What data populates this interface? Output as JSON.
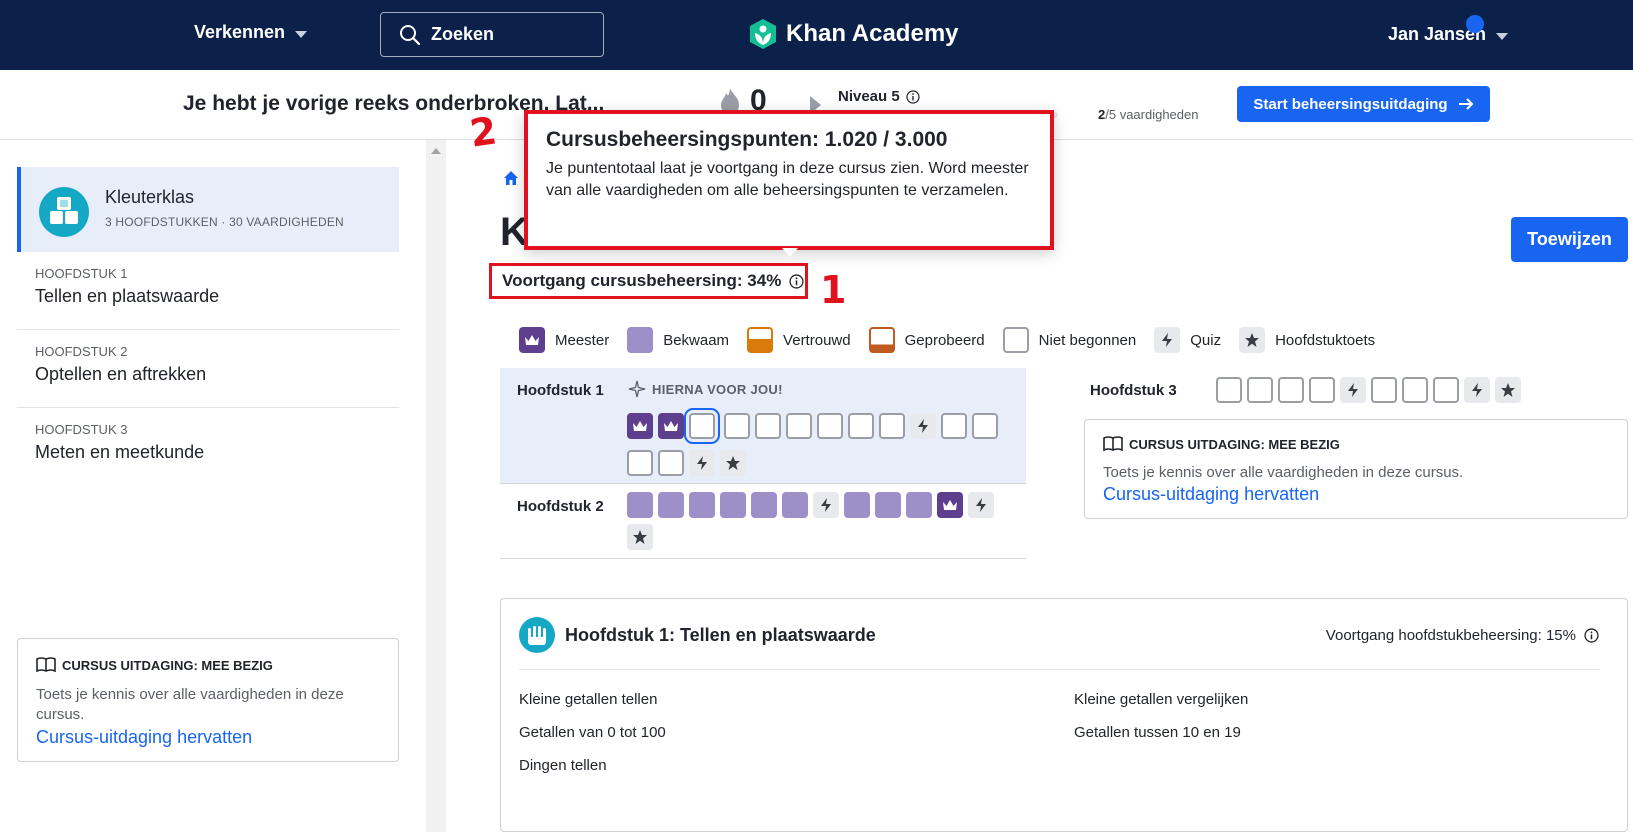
{
  "nav": {
    "explore": "Verkennen",
    "search_label": "Zoeken",
    "logo": "Khan Academy",
    "user": "Jan Jansen"
  },
  "streak": {
    "message": "Je hebt je vorige reeks onderbroken. Lat...",
    "count": "0",
    "level": "Niveau 5",
    "skills_done": "2",
    "skills_total": "/5 vaardigheden",
    "level_fraction": 0.4,
    "start_button": "Start beheersingsuitdaging"
  },
  "sidebar": {
    "course_title": "Kleuterklas",
    "course_meta": "3 HOOFDSTUKKEN · 30 VAARDIGHEDEN",
    "units": [
      {
        "label": "HOOFDSTUK 1",
        "title": "Tellen en plaatswaarde"
      },
      {
        "label": "HOOFDSTUK 2",
        "title": "Optellen en aftrekken"
      },
      {
        "label": "HOOFDSTUK 3",
        "title": "Meten en meetkunde"
      }
    ],
    "challenge_title": "CURSUS UITDAGING: MEE BEZIG",
    "challenge_desc": "Toets je kennis over alle vaardigheden in deze cursus.",
    "challenge_link": "Cursus-uitdaging hervatten"
  },
  "main": {
    "title_partial": "K",
    "assign_button": "Toewijzen",
    "mastery_progress": "Voortgang cursusbeheersing: 34%",
    "annotation_1": "1",
    "annotation_2": "2",
    "tooltip": {
      "title": "Cursusbeheersingspunten: 1.020 / 3.000",
      "body": "Je puntentotaal laat je voortgang in deze cursus zien. Word meester van alle vaardigheden om alle beheersingspunten te verzamelen."
    },
    "legend": {
      "master": "Meester",
      "proficient": "Bekwaam",
      "familiar": "Vertrouwd",
      "attempted": "Geprobeerd",
      "not_started": "Niet begonnen",
      "quiz": "Quiz",
      "unit_test": "Hoofdstuktoets"
    },
    "unit1": {
      "name": "Hoofdstuk 1",
      "up_next": "HIERNA VOOR JOU!"
    },
    "unit2": {
      "name": "Hoofdstuk 2"
    },
    "unit3": {
      "name": "Hoofdstuk 3"
    },
    "challenge_title": "CURSUS UITDAGING: MEE BEZIG",
    "challenge_desc": "Toets je kennis over alle vaardigheden in deze cursus.",
    "challenge_link": "Cursus-uitdaging hervatten",
    "unit_card": {
      "title": "Hoofdstuk 1: Tellen en plaatswaarde",
      "progress": "Voortgang hoofdstukbeheersing: 15%",
      "skills_left": [
        "Kleine getallen tellen",
        "Getallen van 0 tot 100",
        "Dingen tellen"
      ],
      "skills_right": [
        "Kleine getallen vergelijken",
        "Getallen tussen 10 en 19"
      ]
    }
  },
  "colors": {
    "nav_bg": "#0b2149",
    "accent": "#1865f2",
    "master": "#5e3f8e",
    "proficient": "#9d8fc7",
    "familiar": "#d87b0a",
    "attempted": "#c05a1f",
    "annotation": "#e0121d"
  }
}
